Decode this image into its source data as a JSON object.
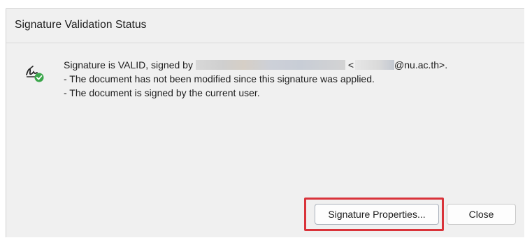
{
  "dialog": {
    "title": "Signature Validation Status"
  },
  "message": {
    "line1_prefix": "Signature is VALID, signed by",
    "line1_mid": " <",
    "line1_suffix": "@nu.ac.th>.",
    "line2": "- The document has not been modified since this signature was applied.",
    "line3": "- The document is signed by the current user."
  },
  "buttons": {
    "properties_label": "Signature Properties...",
    "close_label": "Close"
  },
  "colors": {
    "dialog_bg": "#f0f0f0",
    "highlight": "#d9333a",
    "valid_check": "#3aa64a"
  },
  "icons": {
    "status": "signature-valid-icon"
  }
}
